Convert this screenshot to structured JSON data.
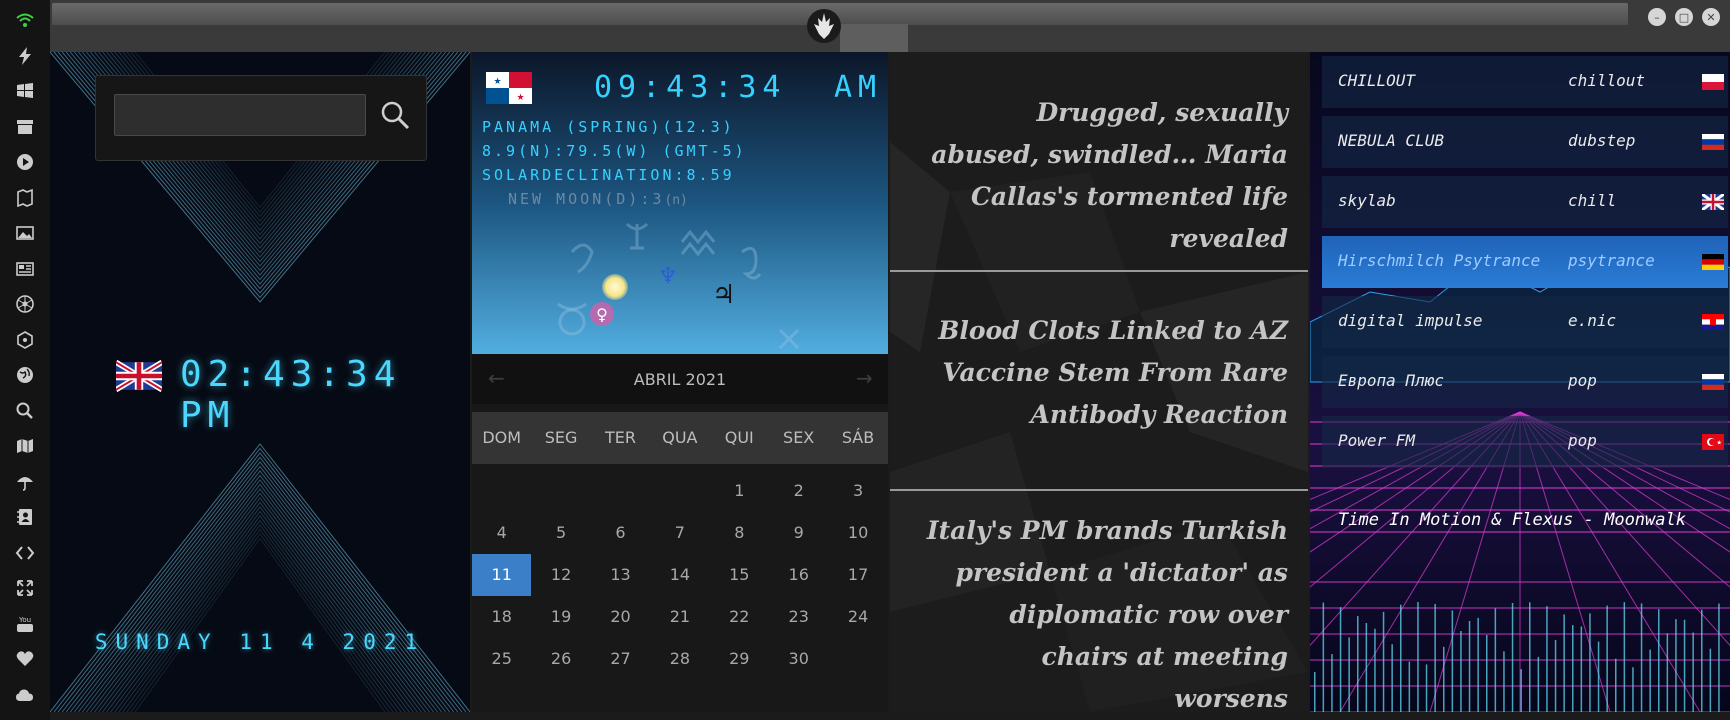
{
  "dock": {
    "icons": [
      "wifi-icon",
      "bolt-icon",
      "windows-icon",
      "archive-icon",
      "play-icon",
      "map-book-icon",
      "image-icon",
      "news-icon",
      "atom-icon",
      "molecule-icon",
      "globe-icon",
      "search-icon",
      "map-icon",
      "umbrella-icon",
      "contacts-icon",
      "code-icon",
      "expand-icon",
      "youtube-icon",
      "heart-icon",
      "cloud-icon"
    ],
    "accent": "#3fd13f"
  },
  "window": {
    "logo": "rebel-alliance-icon"
  },
  "search": {
    "placeholder": "",
    "value": ""
  },
  "clock": {
    "time": "02:43:34 PM",
    "date": "SUNDAY 11 4 2021",
    "flag": "uk-flag"
  },
  "astro": {
    "flag": "panama-flag",
    "time": "09:43:34",
    "ampm": "AM",
    "line1": "PANAMA (SPRING)(12.3)",
    "line2": "8.9(N):79.5(W) (GMT-5)",
    "line3": "SOLARDECLINATION:8.59",
    "moon": "NEW MOON(D):3",
    "moon_sym": "(n)",
    "neptune": "♆",
    "jupiter": "♃",
    "venus": "♀"
  },
  "calendar": {
    "month": "ABRIL 2021",
    "prev": "←",
    "next": "→",
    "weekdays": [
      "DOM",
      "SEG",
      "TER",
      "QUA",
      "QUI",
      "SEX",
      "SÁB"
    ],
    "first_weekday": 4,
    "days_in_month": 30,
    "today": 11,
    "accent": "#3a7fc8"
  },
  "news": [
    {
      "title": "Drugged, sexually abused, swindled… Maria Callas's tormented life revealed"
    },
    {
      "title": "Blood Clots Linked to AZ Vaccine Stem From Rare Antibody Reaction"
    },
    {
      "title": "Italy's PM brands Turkish president a 'dictator' as diplomatic row over chairs at meeting worsens"
    }
  ],
  "radio": {
    "stations": [
      {
        "name": "CHILLOUT",
        "genre": "chillout",
        "flag": "poland-flag"
      },
      {
        "name": "NEBULA CLUB",
        "genre": "dubstep",
        "flag": "russia-flag"
      },
      {
        "name": "skylab",
        "genre": "chill",
        "flag": "uk-flag"
      },
      {
        "name": "Hirschmilch Psytrance",
        "genre": "psytrance",
        "flag": "germany-flag",
        "active": true
      },
      {
        "name": "digital impulse",
        "genre": "e.nic",
        "flag": "croatia-flag"
      },
      {
        "name": "Европа Плюс",
        "genre": "pop",
        "flag": "russia-flag"
      },
      {
        "name": "Power FM",
        "genre": "pop",
        "flag": "turkey-flag"
      }
    ],
    "now_playing": "Time In Motion & Flexus - Moonwalk"
  }
}
